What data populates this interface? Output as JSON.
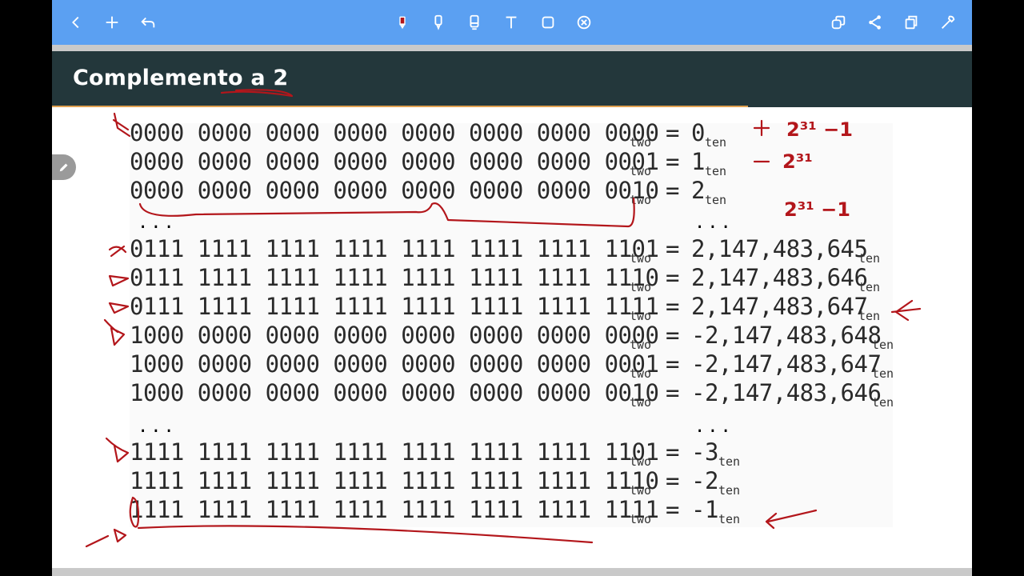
{
  "toolbar": {
    "left": [
      "back-icon",
      "add-icon",
      "undo-icon"
    ],
    "tools": [
      "pen-icon",
      "highlighter-icon",
      "eraser-icon",
      "text-icon",
      "shape-icon",
      "close-circle-icon"
    ],
    "right": [
      "layers-icon",
      "share-icon",
      "copy-icon",
      "settings-icon"
    ],
    "accent_color": "#5ba0f2",
    "pen_color": "#b3161b"
  },
  "slide": {
    "title": "Complemento a 2",
    "header_color": "#23373b",
    "rows": [
      {
        "bits": "0000 0000 0000 0000 0000 0000 0000 0000",
        "base": "two",
        "eq": "=",
        "dec": "0",
        "dec_base": "ten"
      },
      {
        "bits": "0000 0000 0000 0000 0000 0000 0000 0001",
        "base": "two",
        "eq": "=",
        "dec": "1",
        "dec_base": "ten"
      },
      {
        "bits": "0000 0000 0000 0000 0000 0000 0000 0010",
        "base": "two",
        "eq": "=",
        "dec": "2",
        "dec_base": "ten"
      },
      {
        "bits": "0111 1111 1111 1111 1111 1111 1111 1101",
        "base": "two",
        "eq": "=",
        "dec": "2,147,483,645",
        "dec_base": "ten"
      },
      {
        "bits": "0111 1111 1111 1111 1111 1111 1111 1110",
        "base": "two",
        "eq": "=",
        "dec": "2,147,483,646",
        "dec_base": "ten"
      },
      {
        "bits": "0111 1111 1111 1111 1111 1111 1111 1111",
        "base": "two",
        "eq": "=",
        "dec": "2,147,483,647",
        "dec_base": "ten"
      },
      {
        "bits": "1000 0000 0000 0000 0000 0000 0000 0000",
        "base": "two",
        "eq": "=",
        "dec": "-2,147,483,648",
        "dec_base": "ten"
      },
      {
        "bits": "1000 0000 0000 0000 0000 0000 0000 0001",
        "base": "two",
        "eq": "=",
        "dec": "-2,147,483,647",
        "dec_base": "ten"
      },
      {
        "bits": "1000 0000 0000 0000 0000 0000 0000 0010",
        "base": "two",
        "eq": "=",
        "dec": "-2,147,483,646",
        "dec_base": "ten"
      },
      {
        "bits": "1111 1111 1111 1111 1111 1111 1111 1101",
        "base": "two",
        "eq": "=",
        "dec": "-3",
        "dec_base": "ten"
      },
      {
        "bits": "1111 1111 1111 1111 1111 1111 1111 1110",
        "base": "two",
        "eq": "=",
        "dec": "-2",
        "dec_base": "ten"
      },
      {
        "bits": "1111 1111 1111 1111 1111 1111 1111 1111",
        "base": "two",
        "eq": "=",
        "dec": "-1",
        "dec_base": "ten"
      }
    ],
    "ellipsis": "..."
  },
  "annotations": {
    "note1": "+ 2³¹ −1",
    "note2": "− 2³¹",
    "note3": "2³¹ −1"
  }
}
